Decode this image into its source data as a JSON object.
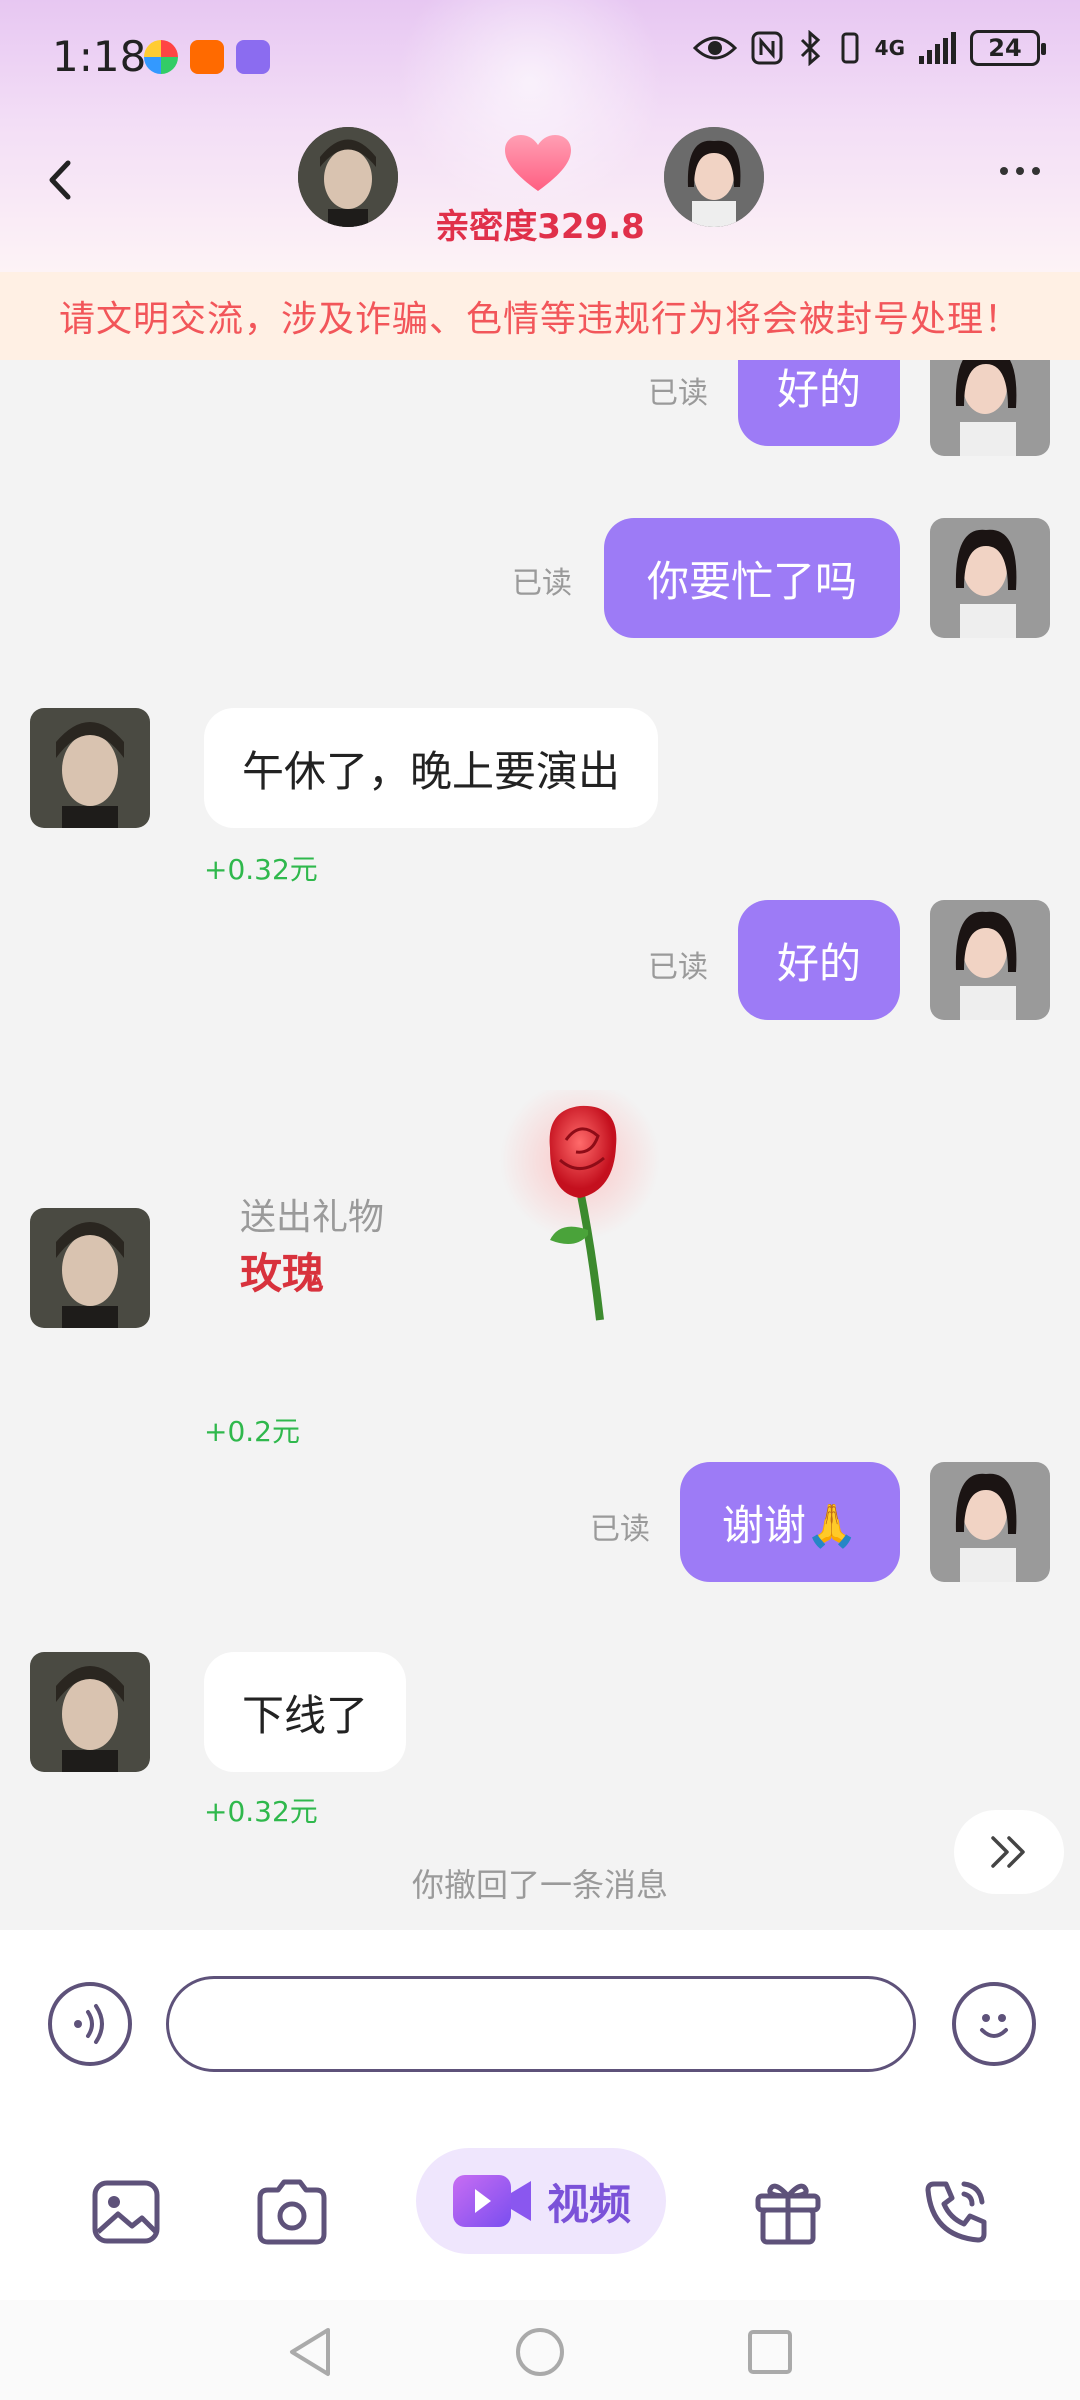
{
  "status": {
    "time": "1:18",
    "network": "4G",
    "battery": "24"
  },
  "header": {
    "intimacy": "亲密度329.8"
  },
  "warning": "请文明交流，涉及诈骗、色情等违规行为将会被封号处理！",
  "messages": [
    {
      "side": "out",
      "text": "好的",
      "read": "已读"
    },
    {
      "side": "out",
      "text": "你要忙了吗",
      "read": "已读"
    },
    {
      "side": "in",
      "text": "午休了，晚上要演出",
      "coin": "+0.32元"
    },
    {
      "side": "out",
      "text": "好的",
      "read": "已读"
    },
    {
      "side": "in",
      "type": "gift",
      "gift_label": "送出礼物",
      "gift_name": "玫瑰",
      "coin": "+0.2元"
    },
    {
      "side": "out",
      "text": "谢谢🙏",
      "read": "已读"
    },
    {
      "side": "in",
      "text": "下线了",
      "coin": "+0.32元"
    }
  ],
  "recall_notice": "你撤回了一条消息",
  "input": {
    "placeholder": "",
    "value": ""
  },
  "toolbar": {
    "video_label": "视频"
  },
  "colors": {
    "accent": "#9d7bf6",
    "warning_text": "#f2565a",
    "coin": "#2fb84c",
    "gift_name": "#d8323d"
  }
}
